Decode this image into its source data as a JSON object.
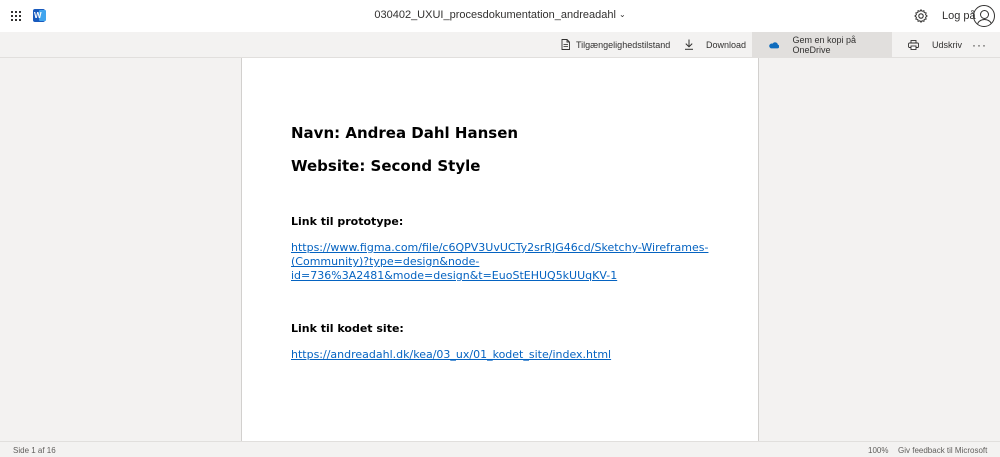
{
  "app": {
    "logo_letter": "W",
    "title": "030402_UXUI_procesdokumentation_andreadahl",
    "sign_in": "Log på"
  },
  "ribbon": {
    "accessibility": "Tilgængelighedstilstand",
    "download": "Download",
    "save_copy": "Gem en kopi på OneDrive",
    "print": "Udskriv",
    "more": "···"
  },
  "document": {
    "heading_name": "Navn: Andrea Dahl Hansen",
    "heading_website": "Website: Second Style",
    "prototype_label": "Link til prototype:",
    "prototype_link_lines": [
      "https://www.figma.com/file/c6QPV3UvUCTy2srRJG46cd/Sketchy-Wireframes-",
      "(Community)?type=design&node-",
      "id=736%3A2481&mode=design&t=EuoStEHUQ5kUUqKV-1"
    ],
    "site_label": "Link til kodet site:",
    "site_link": "https://andreadahl.dk/kea/03_ux/01_kodet_site/index.html"
  },
  "status": {
    "page_indicator": "Side 1 af 16",
    "zoom": "100%",
    "feedback": "Giv feedback til Microsoft"
  },
  "colors": {
    "link": "#0563c1",
    "word_blue": "#185abd",
    "onedrive_blue": "#0f6cbd"
  },
  "icons": [
    "app-launcher-icon",
    "word-logo-icon",
    "chevron-down-icon",
    "gear-icon",
    "avatar-icon",
    "accessibility-icon",
    "download-icon",
    "onedrive-icon",
    "printer-icon",
    "more-icon"
  ]
}
